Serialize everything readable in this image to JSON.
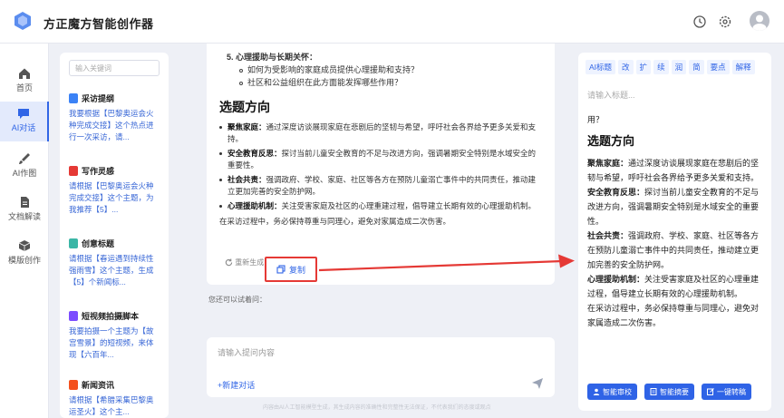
{
  "app": {
    "title": "方正魔方智能创作器"
  },
  "nav": {
    "items": [
      {
        "label": "首页"
      },
      {
        "label": "AI对话"
      },
      {
        "label": "AI作图"
      },
      {
        "label": "文档解读"
      },
      {
        "label": "模版创作"
      }
    ]
  },
  "templates": {
    "search_placeholder": "输入关键词",
    "items": [
      {
        "title": "采访提纲",
        "desc": "我要根据【巴黎奥运会火种完成交接】这个热点进行一次采访，请...",
        "color": "#3b82f6"
      },
      {
        "title": "写作灵感",
        "desc": "请根据【巴黎奥运会火种完成交接】这个主题，为我推荐【5】...",
        "color": "#e53935"
      },
      {
        "title": "创意标题",
        "desc": "请根据【春运遇到持续性强雨雪】这个主题，生成【5】个新闻标...",
        "color": "#3bb6a6"
      },
      {
        "title": "短视频拍摄脚本",
        "desc": "我要拍摄一个主题为【故宫雪景】的短视频，来体现【六百年...",
        "color": "#7c4dff"
      },
      {
        "title": "新闻资讯",
        "desc": "请根据【希腊采集巴黎奥运圣火】这个主...",
        "color": "#f4511e"
      }
    ]
  },
  "chat": {
    "list_heading": "5. 心理援助与长期关怀：",
    "list_items": [
      "如何为受影响的家庭成员提供心理援助和支持？",
      "社区和公益组织在此方面能发挥哪些作用？"
    ],
    "section_title": "选题方向",
    "points": [
      {
        "label": "聚焦家庭：",
        "text": "通过深度访谈展现家庭在悲剧后的坚韧与希望，呼吁社会各界给予更多关爱和支持。"
      },
      {
        "label": "安全教育反思：",
        "text": "探讨当前儿童安全教育的不足与改进方向，强调暑期安全特别是水域安全的重要性。"
      },
      {
        "label": "社会共责：",
        "text": "强调政府、学校、家庭、社区等各方在预防儿童溺亡事件中的共同责任，推动建立更加完善的安全防护网。"
      },
      {
        "label": "心理援助机制：",
        "text": "关注受害家庭及社区的心理重建过程，倡导建立长期有效的心理援助机制。"
      }
    ],
    "closing": "在采访过程中，务必保持尊重与同理心，避免对家属造成二次伤害。",
    "regenerate_label": "重新生成",
    "copy_label": "复制",
    "ask_hint": "您还可以试着问："
  },
  "input": {
    "placeholder": "请输入提问内容",
    "new_chat_label": "+新建对话",
    "footer_note": "内容由AI人工智能模型生成，其生成内容的准确性和完整性无法保证，不代表我们的态度或观点"
  },
  "editor": {
    "tools": [
      "AI标题",
      "改",
      "扩",
      "续",
      "润",
      "简",
      "要点",
      "解释"
    ],
    "title_placeholder": "请输入标题...",
    "body_intro": "用？",
    "section_title": "选题方向",
    "paragraphs": [
      {
        "label": "聚焦家庭：",
        "text": "通过深度访谈展现家庭在悲剧后的坚韧与希望，呼吁社会各界给予更多关爱和支持。"
      },
      {
        "label": "安全教育反思：",
        "text": "探讨当前儿童安全教育的不足与改进方向，强调暑期安全特别是水域安全的重要性。"
      },
      {
        "label": "社会共责：",
        "text": "强调政府、学校、家庭、社区等各方在预防儿童溺亡事件中的共同责任，推动建立更加完善的安全防护网。"
      },
      {
        "label": "心理援助机制：",
        "text": "关注受害家庭及社区的心理重建过程，倡导建立长期有效的心理援助机制。"
      }
    ],
    "closing": "在采访过程中，务必保持尊重与同理心，避免对家属造成二次伤害。",
    "buttons": [
      "智能审校",
      "智能摘要",
      "一键转稿"
    ]
  },
  "colors": {
    "accent": "#3065e6",
    "highlight": "#e53935"
  }
}
